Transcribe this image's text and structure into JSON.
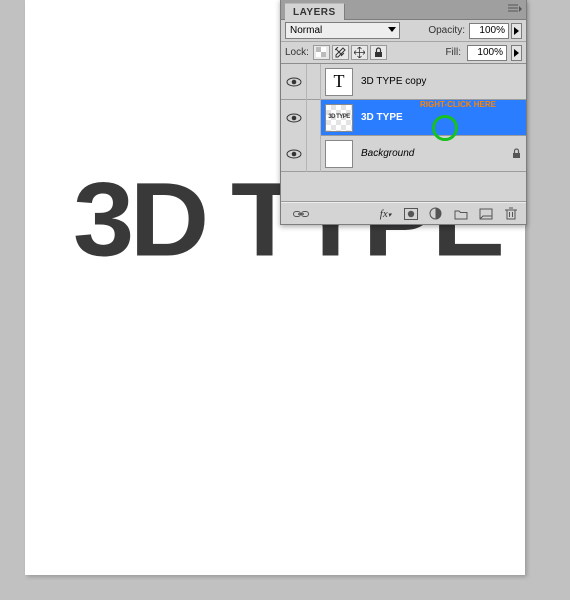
{
  "canvas": {
    "text": "3D TYPE"
  },
  "panel": {
    "title": "LAYERS",
    "blend_mode": "Normal",
    "opacity_label": "Opacity:",
    "opacity_value": "100%",
    "lock_label": "Lock:",
    "fill_label": "Fill:",
    "fill_value": "100%"
  },
  "layers": [
    {
      "name": "3D TYPE copy",
      "thumb": "T",
      "selected": false,
      "locked": false
    },
    {
      "name": "3D TYPE",
      "thumb": "raster",
      "selected": true,
      "locked": false,
      "annotation": "RIGHT-CLICK HERE"
    },
    {
      "name": "Background",
      "thumb": "white",
      "selected": false,
      "locked": true
    }
  ],
  "footer_icons": [
    "link-icon",
    "fx-icon",
    "mask-icon",
    "adjust-icon",
    "group-icon",
    "new-layer-icon",
    "trash-icon"
  ]
}
